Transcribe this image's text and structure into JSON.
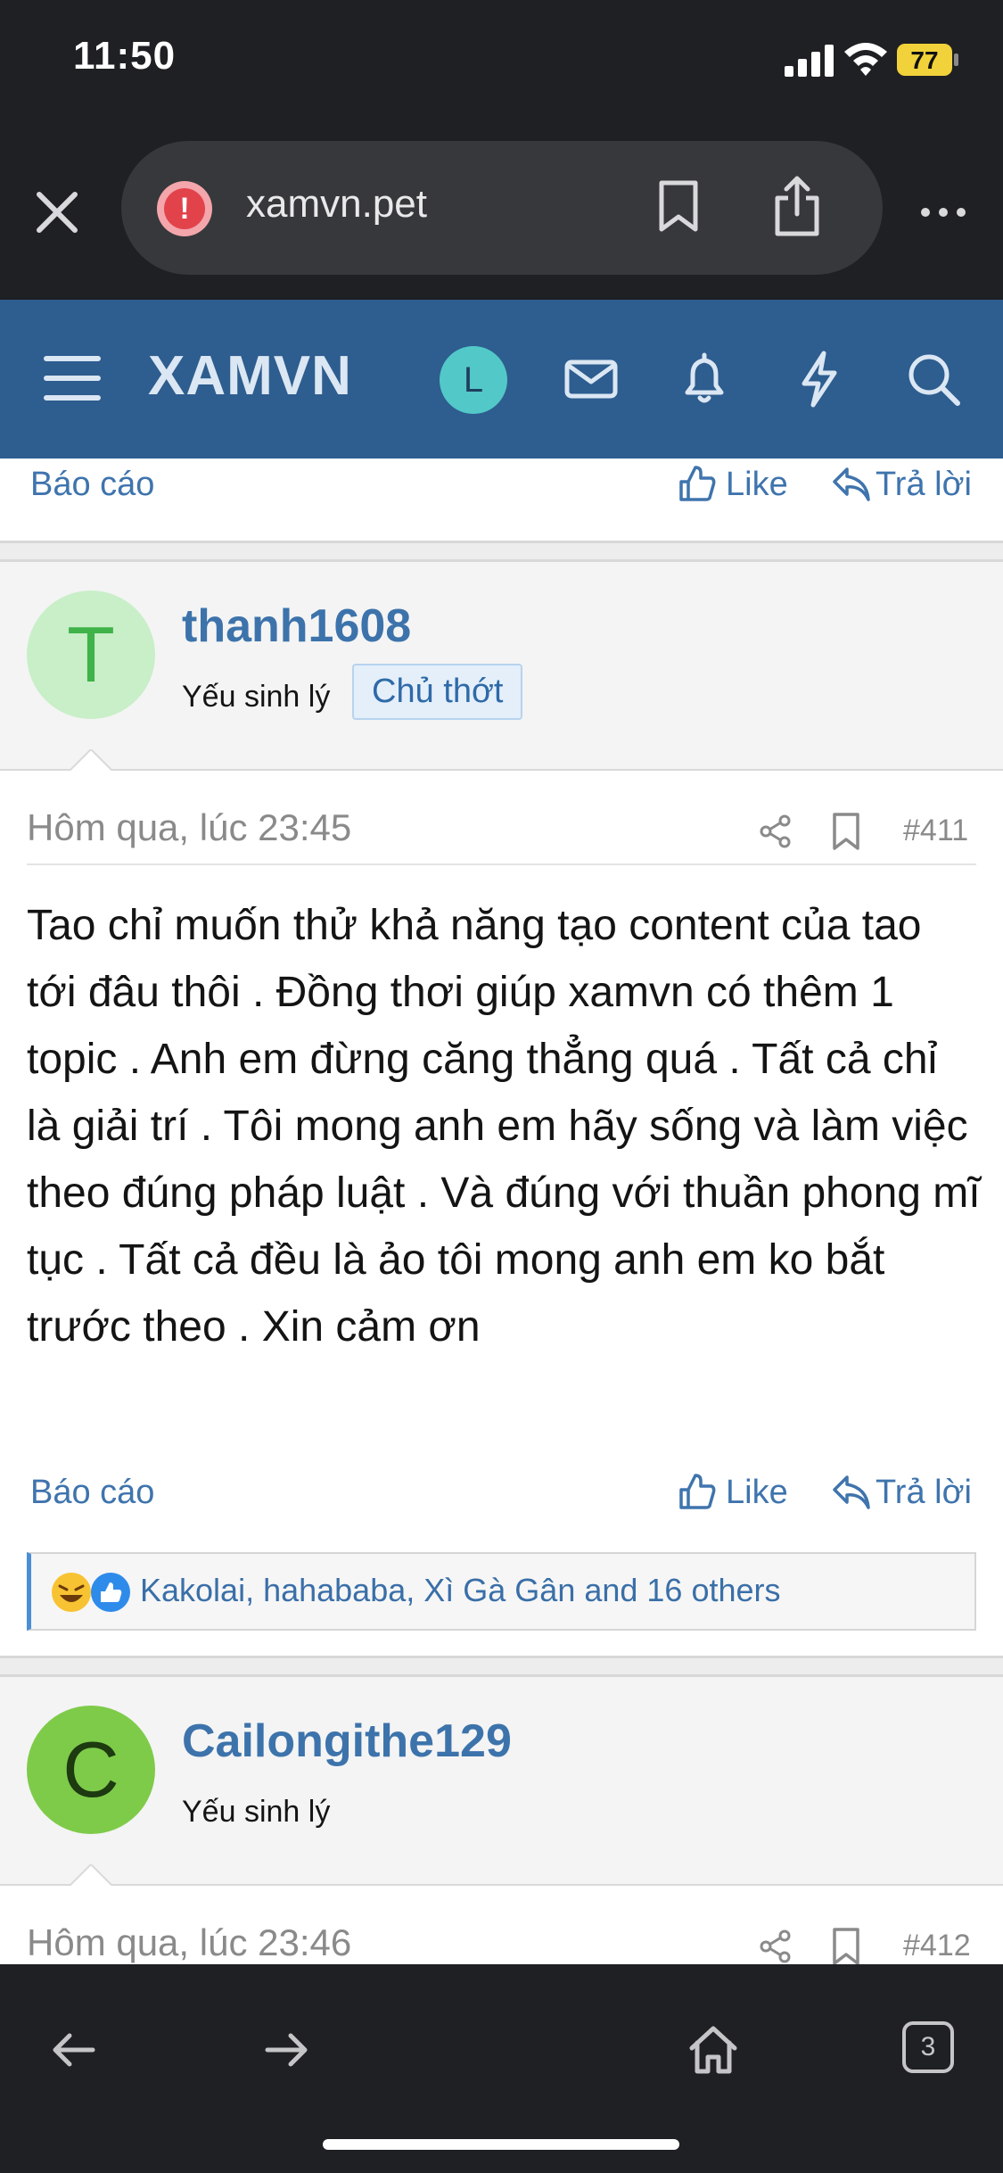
{
  "status": {
    "time": "11:50",
    "battery": "77"
  },
  "browser": {
    "url": "xamvn.pet"
  },
  "site": {
    "logo": "XAMVN",
    "avatar_letter": "L"
  },
  "actions": {
    "report": "Báo cáo",
    "like": "Like",
    "reply": "Trả lời"
  },
  "post1": {
    "avatar_letter": "T",
    "username": "thanh1608",
    "user_title": "Yếu sinh lý",
    "badge": "Chủ thớt",
    "date": "Hôm qua, lúc 23:45",
    "number": "#411",
    "body": "Tao chỉ muốn thử khả năng tạo content của tao tới đâu thôi . Đồng thơi giúp xamvn có thêm 1 topic . Anh em đừng căng thẳng quá . Tất cả chỉ là giải trí . Tôi mong anh em hãy sống và làm việc theo đúng pháp luật . Và đúng với thuần phong mĩ tục . Tất cả đều là ảo tôi mong anh em ko bắt trước theo . Xin cảm ơn",
    "reactions": "Kakolai, hahababa, Xì Gà Gân and 16 others"
  },
  "post2": {
    "avatar_letter": "C",
    "username": "Cailongithe129",
    "user_title": "Yếu sinh lý",
    "date": "Hôm qua, lúc 23:46",
    "number": "#412"
  },
  "toolbar": {
    "tab_count": "3"
  },
  "icons": [
    "close-icon",
    "alert-icon",
    "bookmark-icon",
    "share-icon",
    "more-icon",
    "menu-icon",
    "mail-icon",
    "bell-icon",
    "lightning-icon",
    "search-icon",
    "thumbs-up-icon",
    "reply-icon",
    "back-icon",
    "forward-icon",
    "home-icon",
    "tabs-icon"
  ]
}
